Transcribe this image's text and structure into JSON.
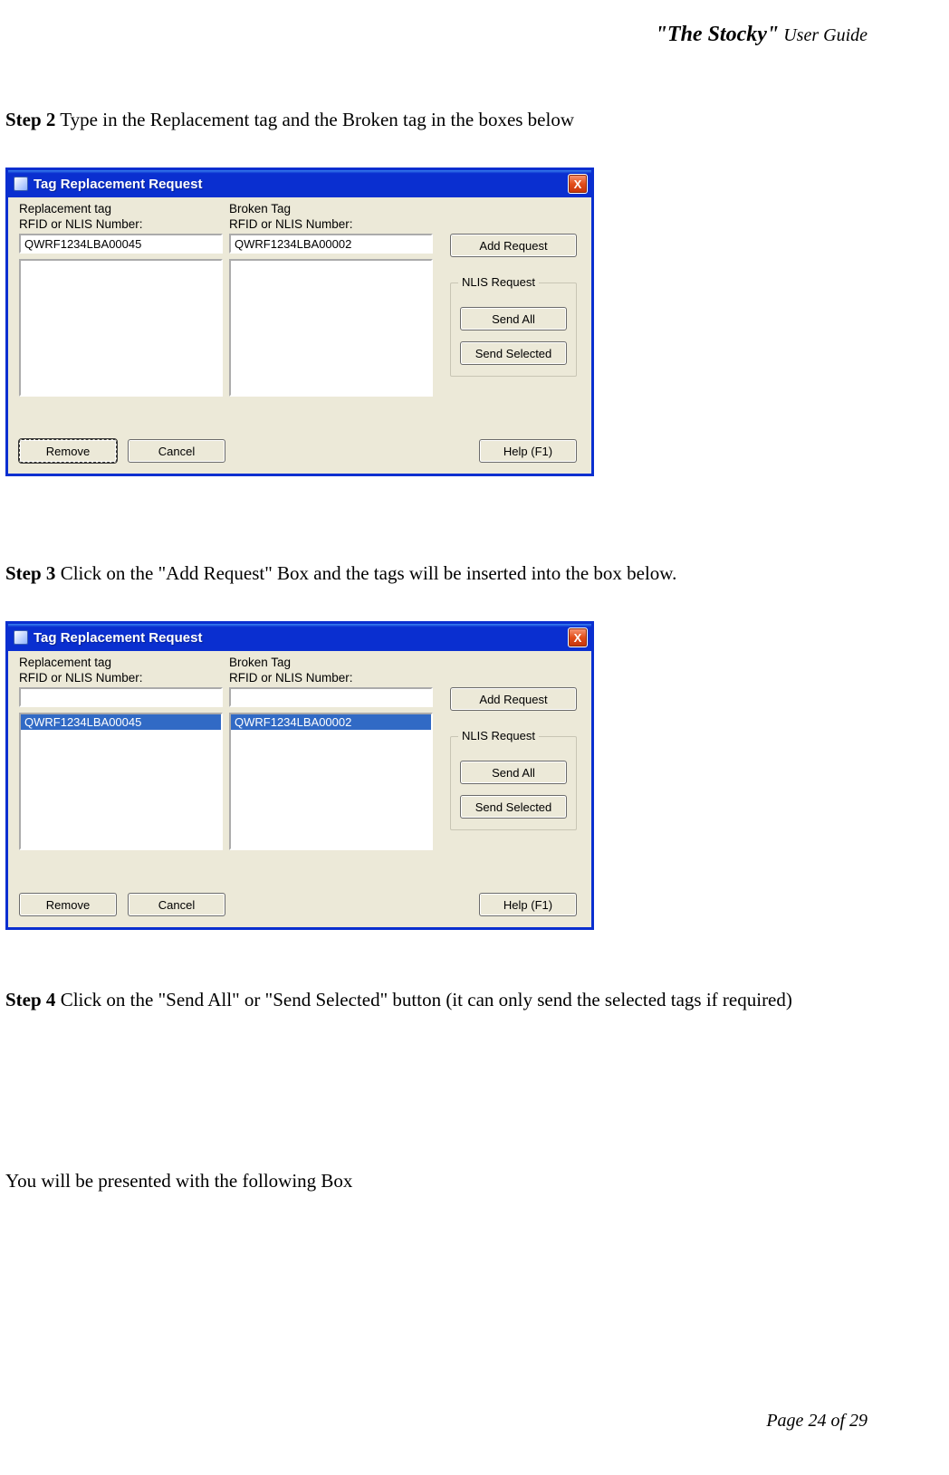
{
  "header": {
    "brand": "\"The Stocky\"",
    "sub": " User Guide"
  },
  "steps": {
    "s2_label": "Step 2",
    "s2_text": " Type in the Replacement tag and the Broken tag in the boxes below",
    "s3_label": "Step 3",
    "s3_text": " Click on the \"Add Request\" Box and the tags will be inserted into the box below.",
    "s4_label": "Step 4",
    "s4_text": " Click on the \"Send All\" or \"Send Selected\" button (it can only send the selected tags if required)",
    "final": "You will be presented with the following Box"
  },
  "dialog": {
    "title": "Tag Replacement Request",
    "close_glyph": "X",
    "replacement_label1": "Replacement tag",
    "replacement_label2": "RFID or NLIS Number:",
    "broken_label1": "Broken Tag",
    "broken_label2": "RFID or NLIS Number:",
    "add_request": "Add Request",
    "nlis_legend": "NLIS Request",
    "send_all": "Send All",
    "send_selected": "Send Selected",
    "remove": "Remove",
    "cancel": "Cancel",
    "help": "Help (F1)"
  },
  "win1": {
    "replacement_value": "QWRF1234LBA00045",
    "broken_value": "QWRF1234LBA00002",
    "replacement_list": [],
    "broken_list": []
  },
  "win2": {
    "replacement_value": "",
    "broken_value": "",
    "replacement_list": [
      "QWRF1234LBA00045"
    ],
    "broken_list": [
      "QWRF1234LBA00002"
    ]
  },
  "footer": "Page 24 of 29"
}
